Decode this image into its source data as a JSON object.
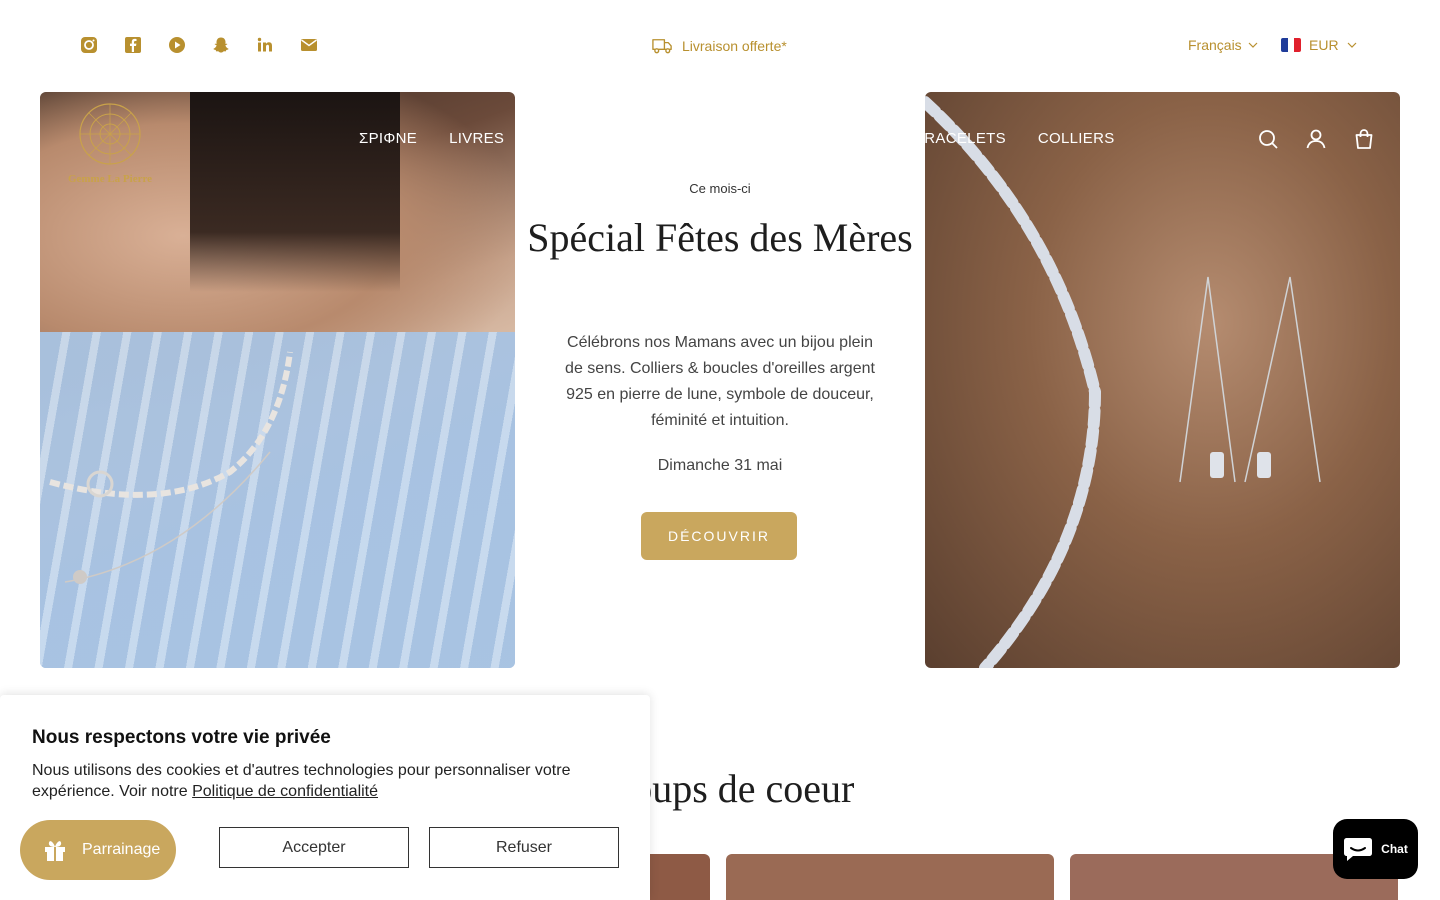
{
  "topbar": {
    "socials": [
      "instagram-icon",
      "facebook-icon",
      "youtube-icon",
      "snapchat-icon",
      "linkedin-icon",
      "mail-icon"
    ],
    "shipping": "Livraison offerte*",
    "language": "Français",
    "currency": "EUR"
  },
  "brand": {
    "name": "Gemme La Pierre",
    "color": "#c9a24a"
  },
  "nav": {
    "left": [
      "ΣΡΙΦΝΕ",
      "LIVRES"
    ],
    "right": [
      "BRACELETS",
      "COLLIERS"
    ]
  },
  "hero": {
    "eyebrow": "Ce mois-ci",
    "title": "Spécial Fêtes des Mères",
    "body": "Célébrons nos Mamans avec un bijou plein de sens. Colliers & boucles d'oreilles argent 925 en pierre de lune, symbole de douceur, féminité et intuition.",
    "date": "Dimanche 31 mai",
    "cta": "DÉCOUVRIR"
  },
  "section": {
    "title": "Nos coups de coeur"
  },
  "cookie": {
    "title": "Nous respectons votre vie privée",
    "text": "Nous utilisons des cookies et d'autres technologies pour personnaliser votre expérience. Voir notre",
    "link": "Politique de confidentialité",
    "accept": "Accepter",
    "refuse": "Refuser"
  },
  "parrainage": "Parrainage",
  "chat": "Chat",
  "colors": {
    "accent": "#c9a75e",
    "gold_text": "#b8902f"
  }
}
